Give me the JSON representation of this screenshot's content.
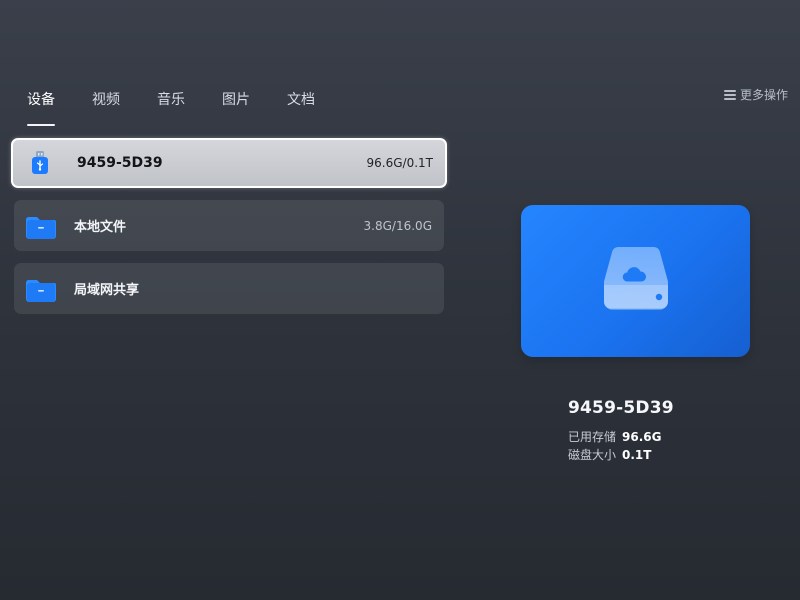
{
  "tabs": [
    {
      "label": "设备",
      "active": true
    },
    {
      "label": "视频",
      "active": false
    },
    {
      "label": "音乐",
      "active": false
    },
    {
      "label": "图片",
      "active": false
    },
    {
      "label": "文档",
      "active": false
    }
  ],
  "more_actions": {
    "label": "更多操作",
    "icon": "menu-icon"
  },
  "items": [
    {
      "name": "9459-5D39",
      "size": "96.6G/0.1T",
      "icon": "usb-drive-icon",
      "selected": true
    },
    {
      "name": "本地文件",
      "size": "3.8G/16.0G",
      "icon": "folder-icon",
      "selected": false
    },
    {
      "name": "局域网共享",
      "size": "",
      "icon": "folder-icon",
      "selected": false
    }
  ],
  "detail": {
    "title": "9459-5D39",
    "used_label": "已用存储",
    "used_value": "96.6G",
    "disk_label": "磁盘大小",
    "disk_value": "0.1T",
    "preview_icon": "cloud-drive-icon"
  },
  "colors": {
    "accent": "#1f7af6",
    "folder": "#1e88ff"
  }
}
